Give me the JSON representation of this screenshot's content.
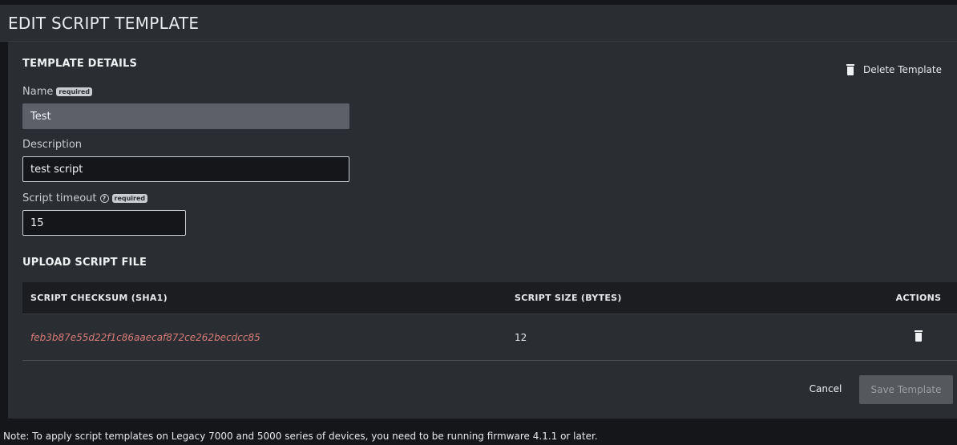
{
  "header": {
    "title": "EDIT SCRIPT TEMPLATE"
  },
  "details": {
    "section_title": "TEMPLATE DETAILS",
    "delete_label": "Delete Template",
    "name_label": "Name",
    "name_required": "required",
    "name_value": "Test",
    "description_label": "Description",
    "description_value": "test script",
    "timeout_label": "Script timeout",
    "timeout_help": "?",
    "timeout_required": "required",
    "timeout_value": "15"
  },
  "upload": {
    "section_title": "UPLOAD SCRIPT FILE",
    "columns": [
      "SCRIPT CHECKSUM (SHA1)",
      "SCRIPT SIZE (BYTES)",
      "ACTIONS"
    ],
    "rows": [
      {
        "checksum": "feb3b87e55d22f1c86aaecaf872ce262becdcc85",
        "size": "12",
        "action_icon": "trash-icon"
      }
    ]
  },
  "actions": {
    "cancel_label": "Cancel",
    "save_label": "Save Template"
  },
  "footer": {
    "note": "Note: To apply script templates on Legacy 7000 and 5000 series of devices, you need to be running firmware 4.1.1 or later."
  }
}
